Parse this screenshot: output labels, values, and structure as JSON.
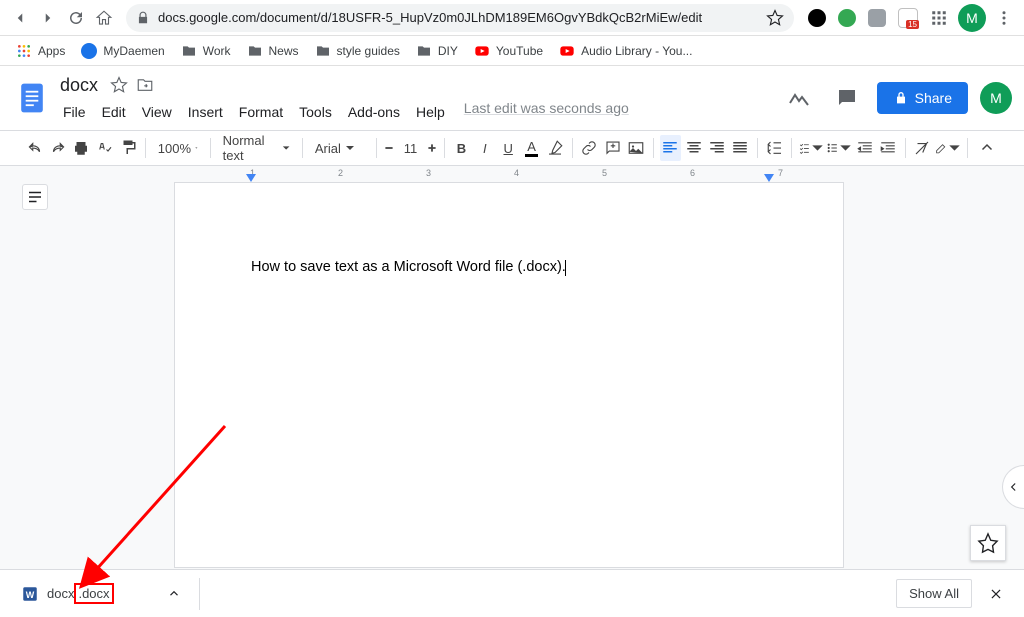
{
  "browser": {
    "url": "docs.google.com/document/d/18USFR-5_HupVz0m0JLhDM189EM6OgvYBdkQcB2rMiEw/edit",
    "profile_initial": "M"
  },
  "bookmarks": [
    {
      "label": "Apps",
      "type": "apps"
    },
    {
      "label": "MyDaemen",
      "type": "globe"
    },
    {
      "label": "Work",
      "type": "folder"
    },
    {
      "label": "News",
      "type": "folder"
    },
    {
      "label": "style guides",
      "type": "folder"
    },
    {
      "label": "DIY",
      "type": "folder"
    },
    {
      "label": "YouTube",
      "type": "youtube"
    },
    {
      "label": "Audio Library - You...",
      "type": "youtube"
    }
  ],
  "doc": {
    "title": "docx",
    "last_edit": "Last edit was seconds ago",
    "menu": [
      "File",
      "Edit",
      "View",
      "Insert",
      "Format",
      "Tools",
      "Add-ons",
      "Help"
    ],
    "share_label": "Share",
    "profile_initial": "M"
  },
  "toolbar": {
    "zoom": "100%",
    "style": "Normal text",
    "font": "Arial",
    "size": "11"
  },
  "content": {
    "text": "How to save text as a Microsoft Word file (.docx)."
  },
  "ruler_numbers": [
    "1",
    "2",
    "3",
    "4",
    "5",
    "6",
    "7"
  ],
  "download": {
    "prefix": "docx",
    "ext": ".docx",
    "show_all": "Show All"
  }
}
